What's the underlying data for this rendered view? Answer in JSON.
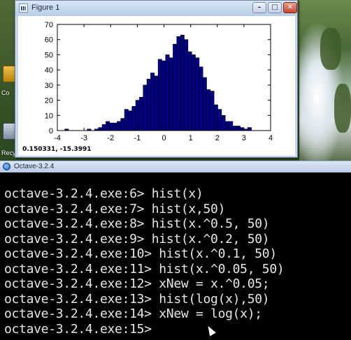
{
  "desktop": {
    "icons": [
      {
        "label": "Co"
      },
      {
        "label": "Recy"
      }
    ]
  },
  "figure_window": {
    "title": "Figure 1",
    "buttons": {
      "minimize": "–",
      "maximize": "□",
      "close": "✕"
    },
    "status_text": "0.150331, -15.3991"
  },
  "chart_data": {
    "type": "bar",
    "title": "",
    "xlabel": "",
    "ylabel": "",
    "xlim": [
      -4,
      4
    ],
    "ylim": [
      0,
      70
    ],
    "xticks": [
      "-4",
      "-3",
      "-2",
      "-1",
      "0",
      "1",
      "2",
      "3",
      "4"
    ],
    "yticks": [
      "0",
      "10",
      "20",
      "30",
      "40",
      "50",
      "60",
      "70"
    ],
    "bar_color": "#000080",
    "bin_edges_start": -3.72,
    "bin_width": 0.14,
    "values": [
      1,
      0,
      0,
      0,
      0,
      0,
      1,
      0,
      1,
      2,
      4,
      6,
      5,
      5,
      6,
      8,
      14,
      13,
      16,
      20,
      22,
      30,
      34,
      38,
      36,
      47,
      46,
      50,
      48,
      57,
      62,
      63,
      60,
      52,
      50,
      48,
      42,
      35,
      27,
      26,
      17,
      14,
      10,
      6,
      6,
      3,
      3,
      2,
      1,
      2
    ]
  },
  "octave_window": {
    "title": "Octave-3.2.4",
    "lines": [
      "octave-3.2.4.exe:6> hist(x)",
      "octave-3.2.4.exe:7> hist(x,50)",
      "octave-3.2.4.exe:8> hist(x.^0.5, 50)",
      "octave-3.2.4.exe:9> hist(x.^0.2, 50)",
      "octave-3.2.4.exe:10> hist(x.^0.1, 50)",
      "octave-3.2.4.exe:11> hist(x.^0.05, 50)",
      "octave-3.2.4.exe:12> xNew = x.^0.05;",
      "octave-3.2.4.exe:13> hist(log(x),50)",
      "octave-3.2.4.exe:14> xNew = log(x);",
      "octave-3.2.4.exe:15>"
    ]
  }
}
